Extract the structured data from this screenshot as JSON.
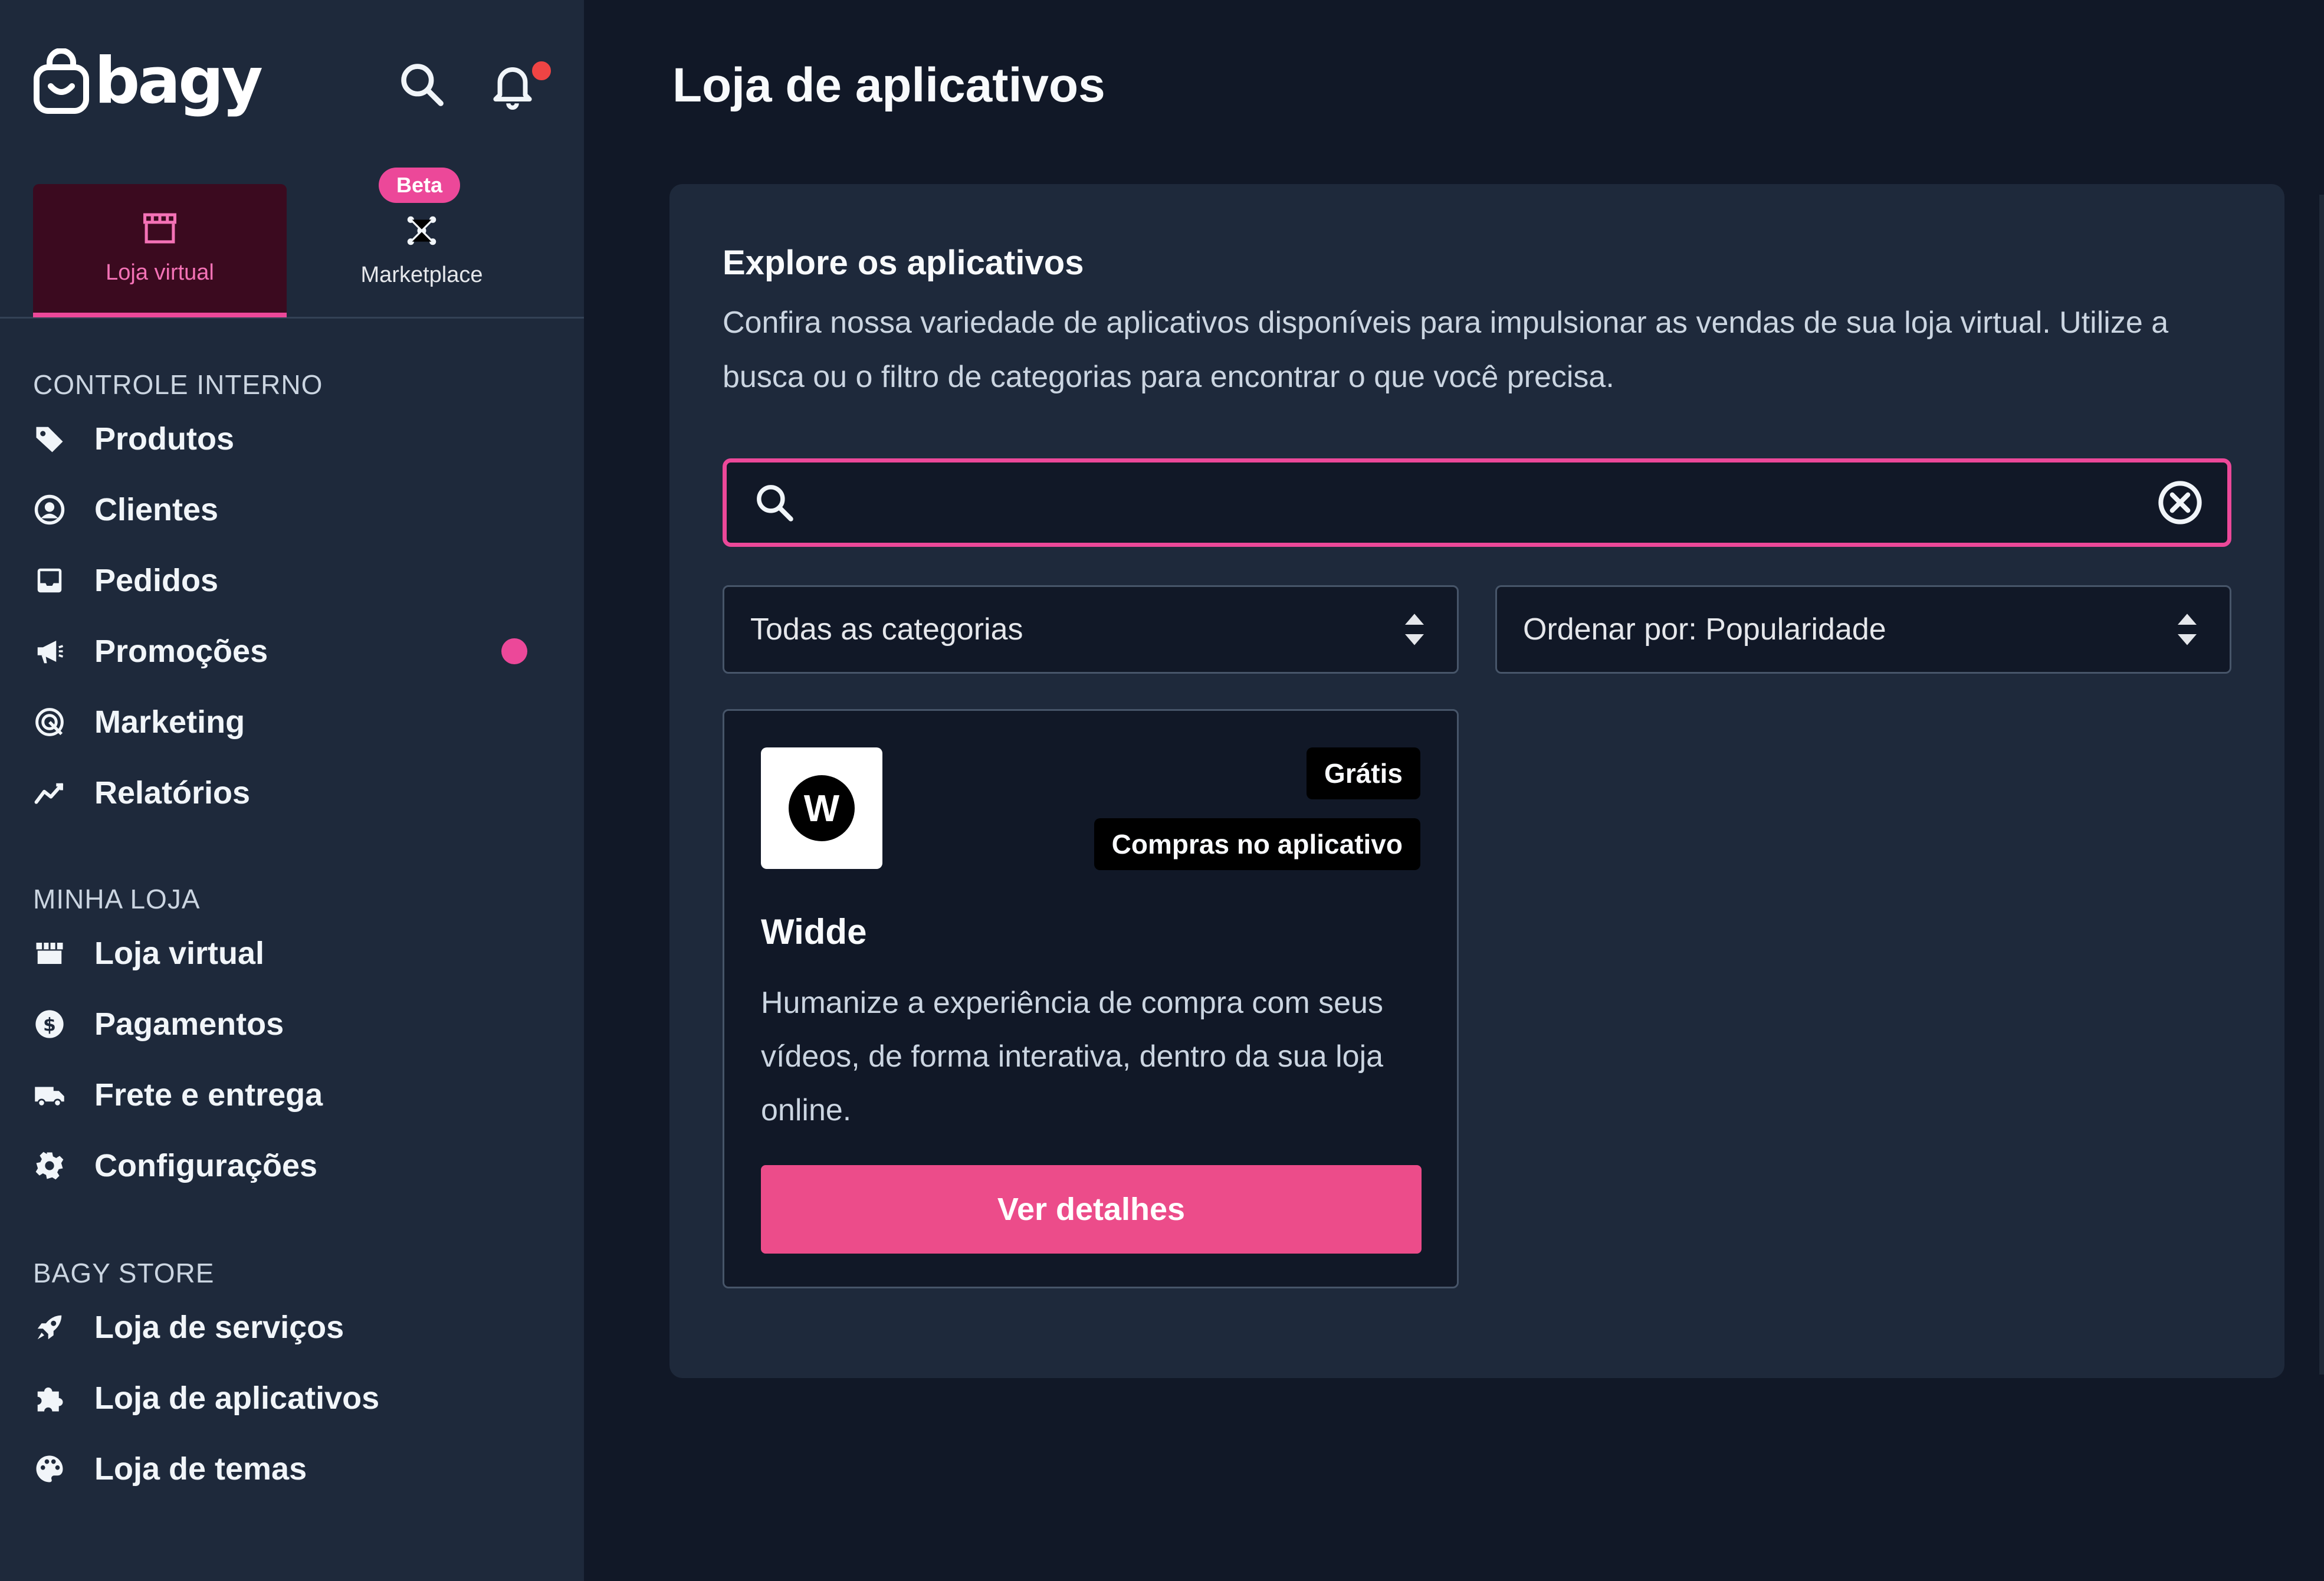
{
  "brand": {
    "logo_text": "bagy"
  },
  "header_icons": [
    "search-icon",
    "bell-icon"
  ],
  "mode_tabs": {
    "store": {
      "label": "Loja virtual",
      "icon": "storefront-icon",
      "active": true
    },
    "marketplace": {
      "label": "Marketplace",
      "icon": "network-icon",
      "badge": "Beta"
    }
  },
  "sidebar": {
    "sections": [
      {
        "header": "CONTROLE INTERNO",
        "items": [
          {
            "label": "Produtos",
            "icon": "tag-icon"
          },
          {
            "label": "Clientes",
            "icon": "user-circle-icon"
          },
          {
            "label": "Pedidos",
            "icon": "inbox-icon"
          },
          {
            "label": "Promoções",
            "icon": "megaphone-icon",
            "dot": true
          },
          {
            "label": "Marketing",
            "icon": "target-icon"
          },
          {
            "label": "Relatórios",
            "icon": "chart-line-icon"
          }
        ]
      },
      {
        "header": "MINHA LOJA",
        "items": [
          {
            "label": "Loja virtual",
            "icon": "store-icon"
          },
          {
            "label": "Pagamentos",
            "icon": "dollar-icon"
          },
          {
            "label": "Frete e entrega",
            "icon": "truck-icon"
          },
          {
            "label": "Configurações",
            "icon": "gear-icon"
          }
        ]
      },
      {
        "header": "BAGY STORE",
        "items": [
          {
            "label": "Loja de serviços",
            "icon": "rocket-icon"
          },
          {
            "label": "Loja de aplicativos",
            "icon": "puzzle-icon"
          },
          {
            "label": "Loja de temas",
            "icon": "palette-icon"
          }
        ]
      }
    ]
  },
  "main": {
    "title": "Loja de aplicativos",
    "panel": {
      "title": "Explore os aplicativos",
      "description": "Confira nossa variedade de aplicativos disponíveis para impulsionar as vendas de sua loja virtual. Utilize a busca ou o filtro de categorias para encontrar o que você precisa."
    },
    "search": {
      "value": "",
      "placeholder": ""
    },
    "filters": {
      "category": "Todas as categorias",
      "sort": "Ordenar por: Popularidade"
    },
    "apps": [
      {
        "logo_letter": "W",
        "name": "Widde",
        "tags": [
          "Grátis",
          "Compras no aplicativo"
        ],
        "description": "Humanize a experiência de compra com seus vídeos, de forma interativa, dentro da sua loja online.",
        "button": "Ver detalhes"
      }
    ]
  },
  "colors": {
    "accent": "#ec4899",
    "sidebar_bg": "#1e293b",
    "page_bg": "#111827",
    "notification": "#ef4444"
  }
}
